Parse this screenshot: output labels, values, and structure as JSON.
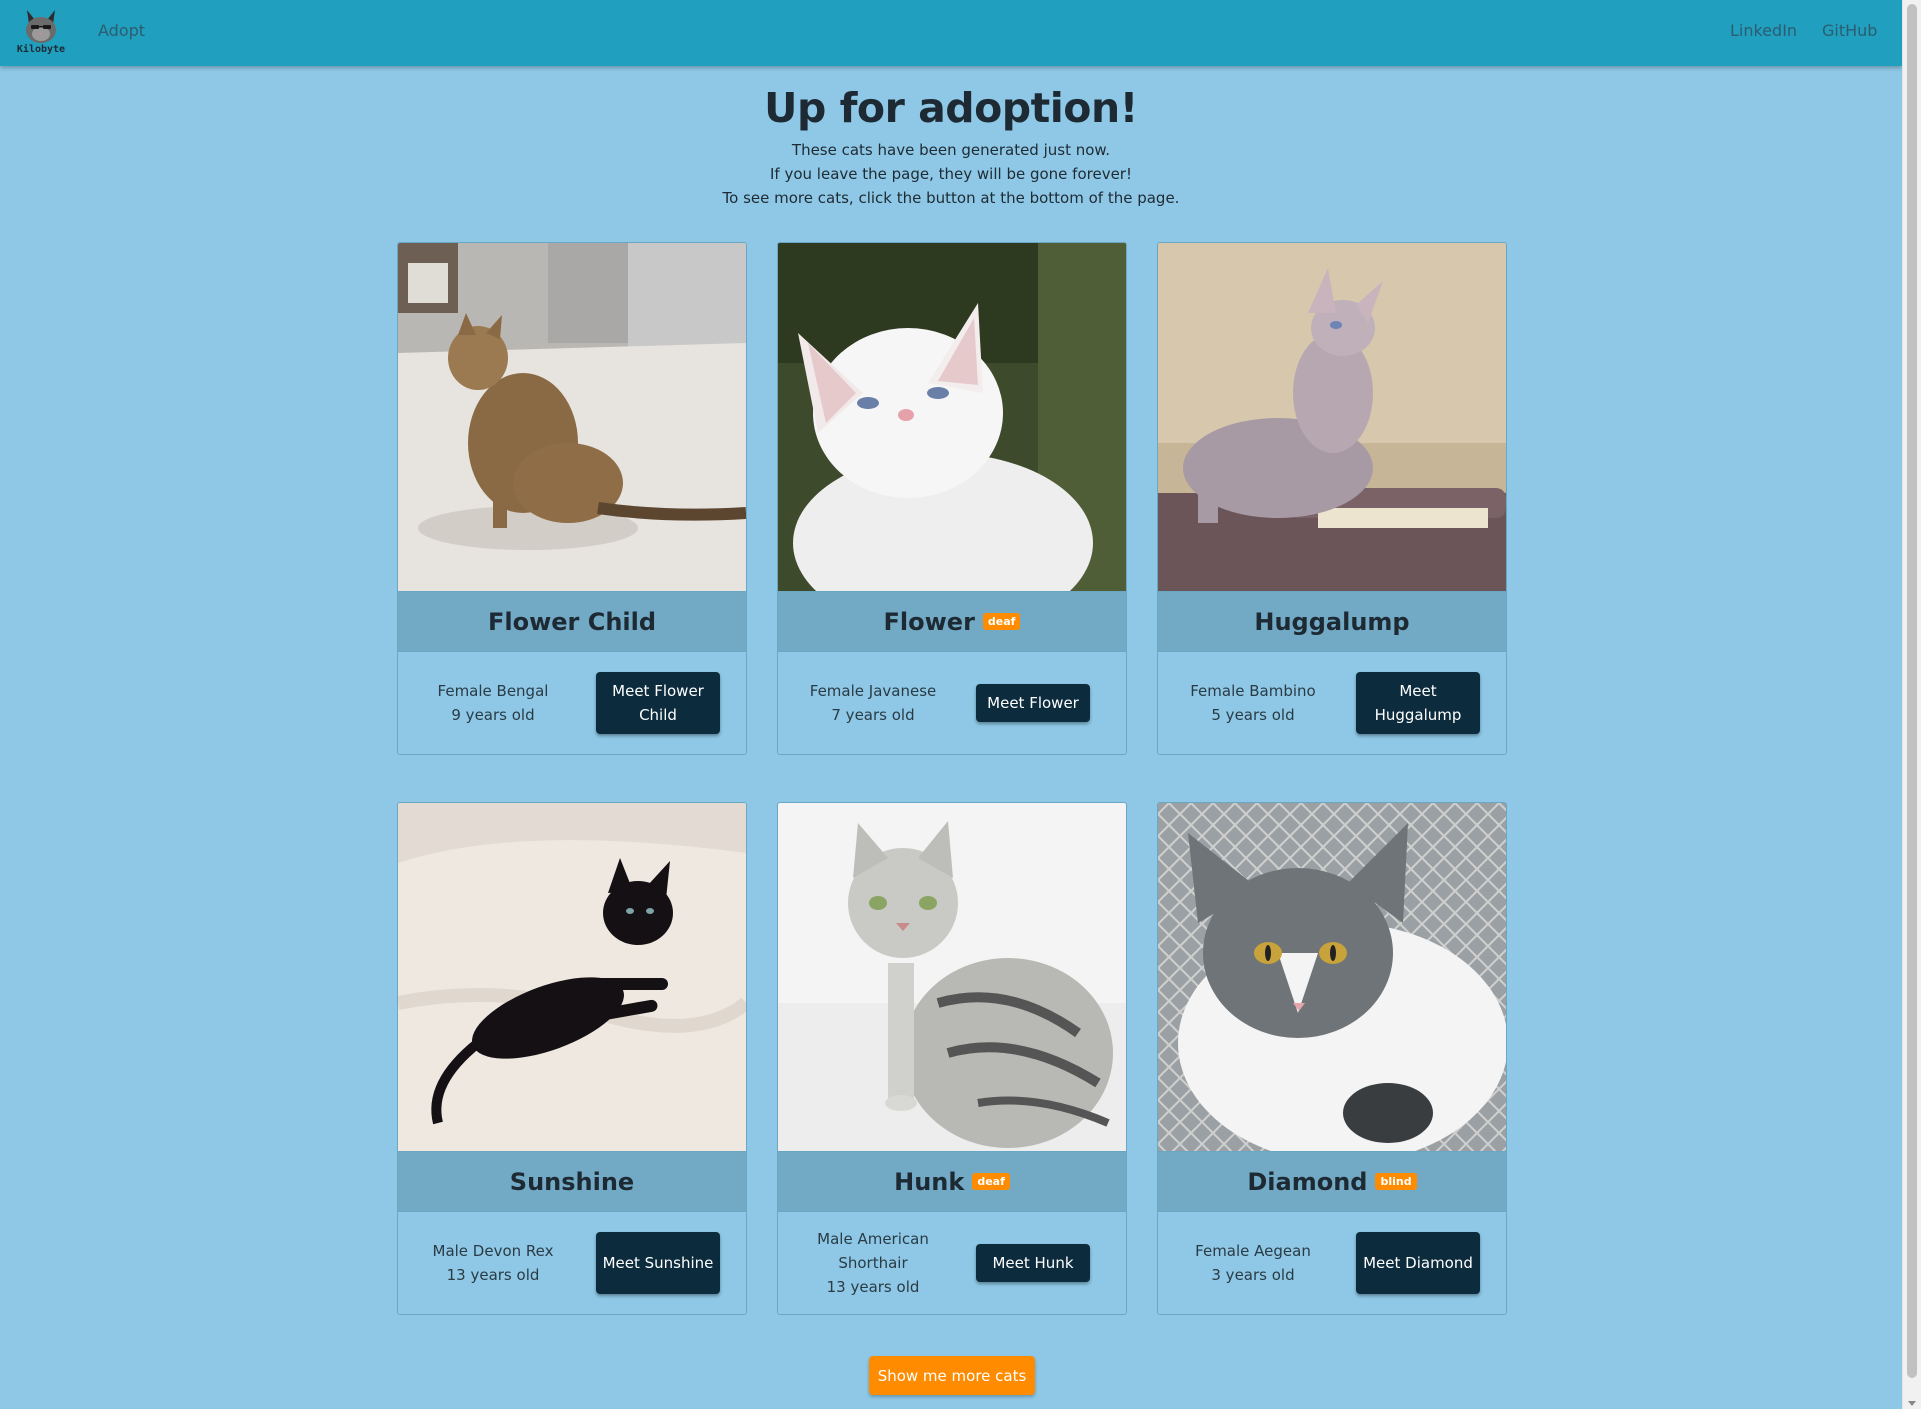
{
  "navbar": {
    "brand_text": "Kilobyte",
    "links": {
      "adopt": "Adopt",
      "linkedin": "LinkedIn",
      "github": "GitHub"
    }
  },
  "hero": {
    "title": "Up for adoption!",
    "lines": [
      "These cats have been generated just now.",
      "If you leave the page, they will be gone forever!",
      "To see more cats, click the button at the bottom of the page."
    ]
  },
  "cats": [
    {
      "name": "Flower Child",
      "badge": "",
      "info_line1": "Female Bengal",
      "info_line2": "9 years old",
      "button": "Meet Flower Child"
    },
    {
      "name": "Flower",
      "badge": "deaf",
      "info_line1": "Female Javanese",
      "info_line2": "7 years old",
      "button": "Meet Flower"
    },
    {
      "name": "Huggalump",
      "badge": "",
      "info_line1": "Female Bambino",
      "info_line2": "5 years old",
      "button": "Meet Huggalump"
    },
    {
      "name": "Sunshine",
      "badge": "",
      "info_line1": "Male Devon Rex",
      "info_line2": "13 years old",
      "button": "Meet Sunshine"
    },
    {
      "name": "Hunk",
      "badge": "deaf",
      "info_line1": "Male American Shorthair",
      "info_line2": "13 years old",
      "button": "Meet Hunk"
    },
    {
      "name": "Diamond",
      "badge": "blind",
      "info_line1": "Female Aegean",
      "info_line2": "3 years old",
      "button": "Meet Diamond"
    }
  ],
  "more_button": "Show me more cats",
  "colors": {
    "navbar": "#209fbf",
    "page_background": "#8ec8e6",
    "card_title_bar": "#72a9c5",
    "meet_button": "#0c2b3d",
    "badge": "#ff8c00",
    "more_button": "#ff8c00"
  }
}
